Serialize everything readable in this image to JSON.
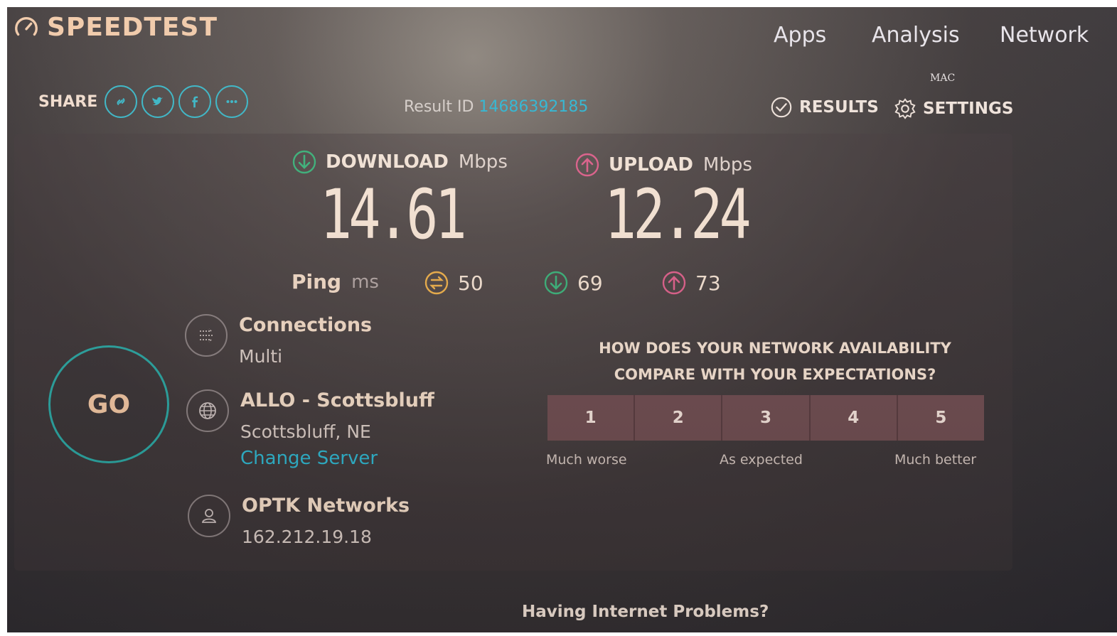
{
  "app": {
    "logo_text": "SPEEDTEST"
  },
  "nav": {
    "apps": "Apps",
    "analysis": "Analysis",
    "network": "Network"
  },
  "mac_label": "MAC",
  "share": {
    "label": "SHARE",
    "buttons": [
      {
        "icon": "link-icon"
      },
      {
        "icon": "twitter-icon"
      },
      {
        "icon": "facebook-icon"
      },
      {
        "icon": "more-icon"
      }
    ]
  },
  "result": {
    "label": "Result ID",
    "id": "14686392185"
  },
  "tools": {
    "results": "RESULTS",
    "settings": "SETTINGS"
  },
  "download": {
    "label": "DOWNLOAD",
    "unit": "Mbps",
    "value": "14.61",
    "color": "#3bb37a"
  },
  "upload": {
    "label": "UPLOAD",
    "unit": "Mbps",
    "value": "12.24",
    "color": "#e0608c"
  },
  "ping": {
    "label": "Ping",
    "unit": "ms",
    "idle": "50",
    "download": "69",
    "upload": "73",
    "idle_color": "#f0b14a"
  },
  "go_label": "GO",
  "connections": {
    "title": "Connections",
    "value": "Multi"
  },
  "server": {
    "title": "ALLO - Scottsbluff",
    "location": "Scottsbluff, NE",
    "change_link": "Change Server"
  },
  "isp": {
    "title": "OPTK Networks",
    "ip": "162.212.19.18"
  },
  "survey": {
    "question_line1": "HOW DOES YOUR NETWORK AVAILABILITY",
    "question_line2": "COMPARE WITH YOUR EXPECTATIONS?",
    "options": [
      "1",
      "2",
      "3",
      "4",
      "5"
    ],
    "low_caption": "Much worse",
    "mid_caption": "As expected",
    "high_caption": "Much better"
  },
  "footer": {
    "problems": "Having Internet Problems?"
  },
  "colors": {
    "accent": "#2fb7d4",
    "go_ring": "#2aa6a2",
    "rating_bg": "#6f4c50"
  }
}
